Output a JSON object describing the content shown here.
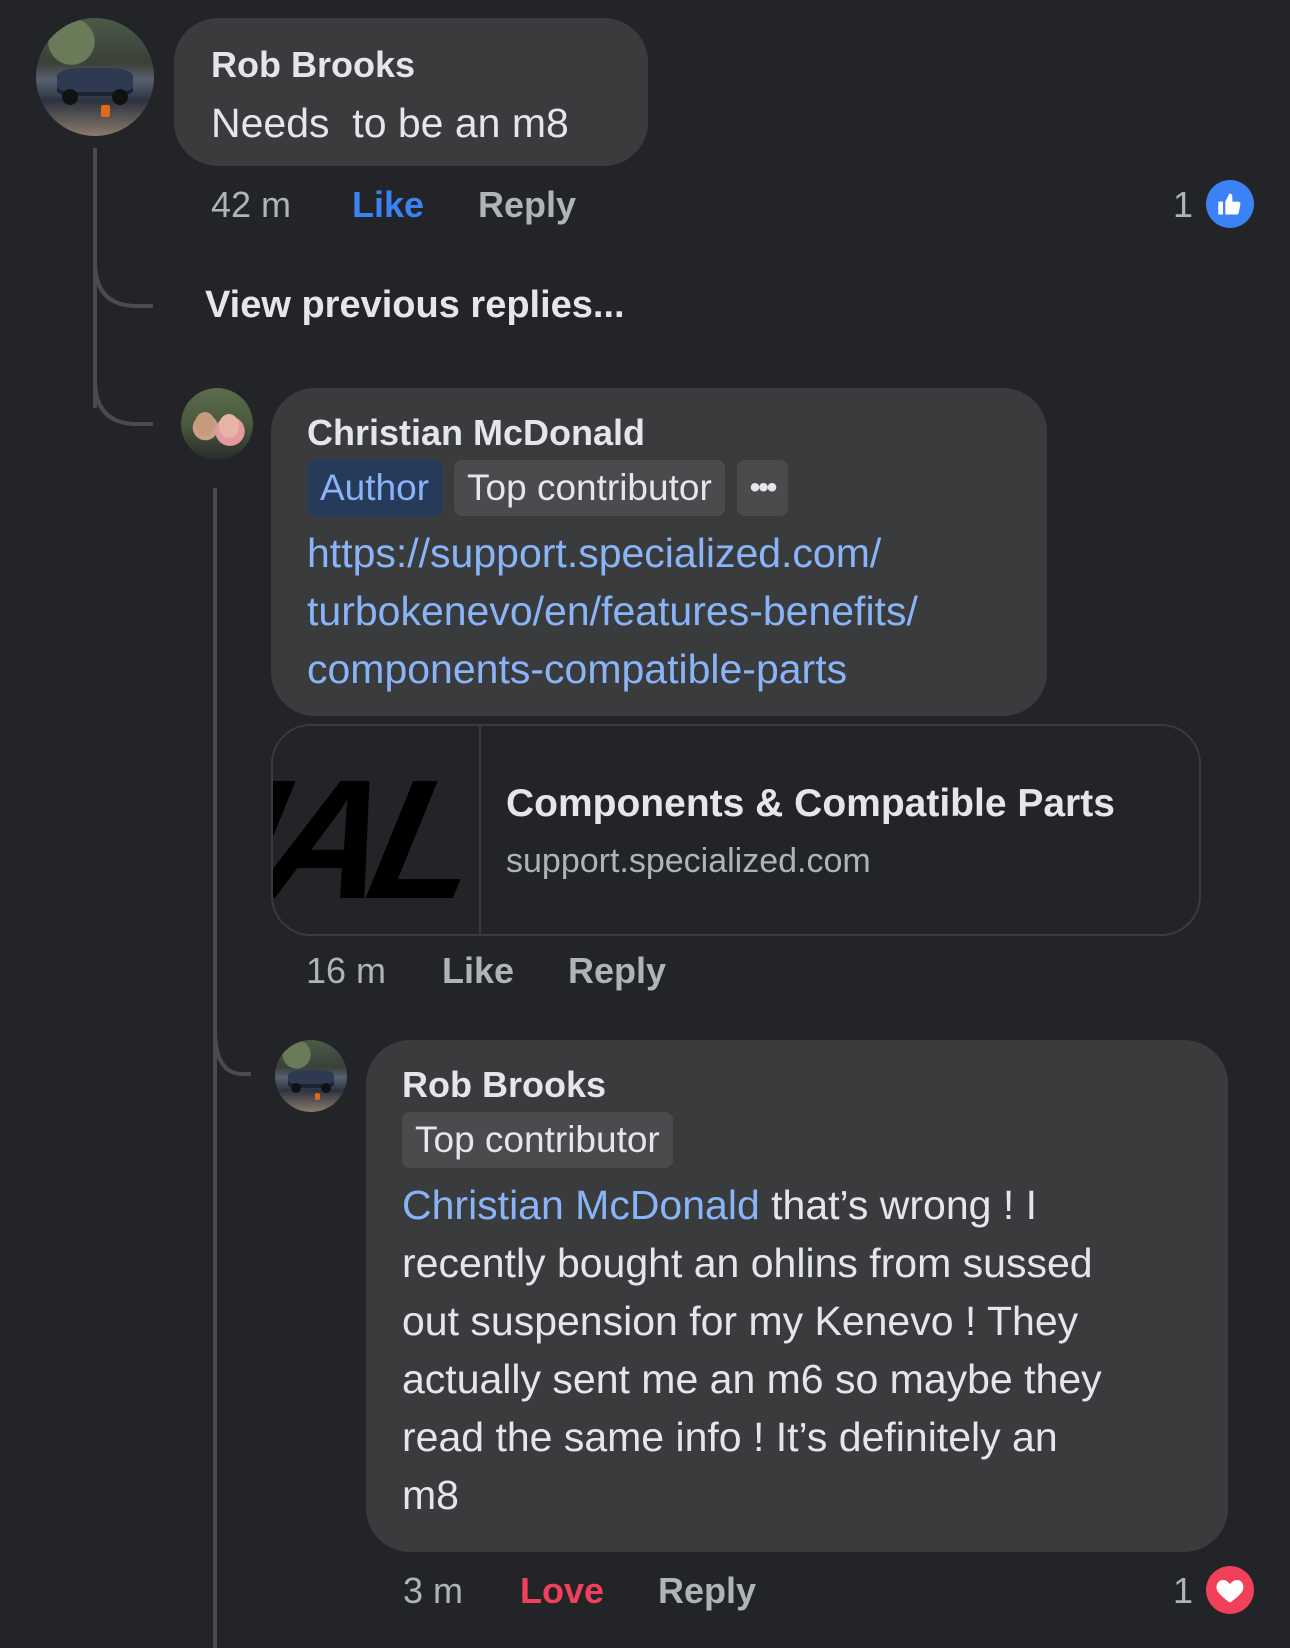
{
  "colors": {
    "background": "#232427",
    "bubble": "#3a3b3c",
    "like_blue": "#3b82f6",
    "love_red": "#f0405a",
    "link": "#8ab4f8"
  },
  "comment1": {
    "author": "Rob Brooks",
    "text": "Needs  to be an m8",
    "time": "42 m",
    "like_label": "Like",
    "reply_label": "Reply",
    "reaction_count": "1",
    "reaction_icon": "thumbs-up-icon"
  },
  "view_previous": "View previous replies...",
  "comment2": {
    "author": "Christian McDonald",
    "badge_author": "Author",
    "badge_top": "Top contributor",
    "more_label": "•••",
    "link_lines": [
      "https://support.specialized.com/",
      "turbokenevo/en/features-benefits/",
      "components-compatible-parts"
    ],
    "preview": {
      "thumbnail_text": "IAL",
      "title": "Components & Compatible Parts",
      "domain": "support.specialized.com"
    },
    "time": "16 m",
    "like_label": "Like",
    "reply_label": "Reply"
  },
  "comment3": {
    "author": "Rob Brooks",
    "badge_top": "Top contributor",
    "mention": "Christian McDonald",
    "text_lines": [
      " that’s wrong ! I",
      "recently bought an ohlins from sussed",
      "out suspension for my Kenevo ! They",
      "actually sent me an m6 so maybe they",
      "read the same info ! It’s definitely an",
      "m8"
    ],
    "time": "3 m",
    "love_label": "Love",
    "reply_label": "Reply",
    "reaction_count": "1",
    "reaction_icon": "heart-icon"
  }
}
